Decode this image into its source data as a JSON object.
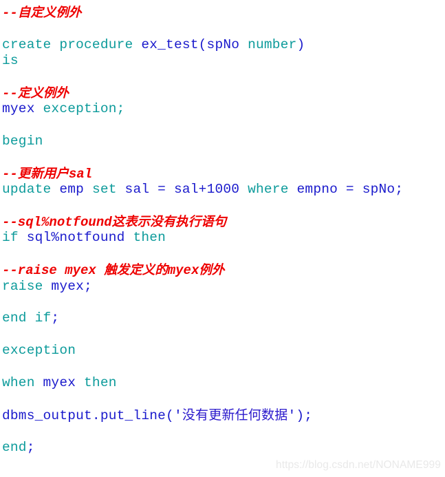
{
  "page": {
    "kind": "code-snippet",
    "language": "PL/SQL",
    "background_color": "#ffffff"
  },
  "colors": {
    "keyword": "#0d9b9b",
    "identifier": "#1a1acc",
    "string": "#2b1acc",
    "comment": "#ee0000",
    "watermark": "#e9e9e9"
  },
  "code": {
    "lines": [
      {
        "type": "comment",
        "text": "--自定义例外",
        "parts": [
          {
            "t": "--",
            "cls": "latin"
          },
          {
            "t": "自定义例外",
            "cls": "cn"
          }
        ]
      },
      {
        "type": "blank",
        "text": ""
      },
      {
        "type": "code",
        "text": "create procedure ex_test(spNo number)",
        "tokens": [
          {
            "t": "create procedure ",
            "k": "kw"
          },
          {
            "t": "ex_test(spNo",
            "k": "id"
          },
          {
            "t": " number",
            "k": "kw"
          },
          {
            "t": ")",
            "k": "id"
          }
        ]
      },
      {
        "type": "code",
        "text": "is",
        "tokens": [
          {
            "t": "is",
            "k": "kw"
          }
        ]
      },
      {
        "type": "blank",
        "text": ""
      },
      {
        "type": "comment",
        "text": "--定义例外",
        "parts": [
          {
            "t": "--",
            "cls": "latin"
          },
          {
            "t": "定义例外",
            "cls": "cn"
          }
        ]
      },
      {
        "type": "code",
        "text": "myex exception;",
        "tokens": [
          {
            "t": "myex",
            "k": "id"
          },
          {
            "t": " exception;",
            "k": "kw"
          }
        ]
      },
      {
        "type": "blank",
        "text": ""
      },
      {
        "type": "code",
        "text": "begin",
        "tokens": [
          {
            "t": "begin",
            "k": "kw"
          }
        ]
      },
      {
        "type": "blank",
        "text": ""
      },
      {
        "type": "comment",
        "text": "--更新用户sal",
        "parts": [
          {
            "t": "--",
            "cls": "latin"
          },
          {
            "t": "更新用户",
            "cls": "cn"
          },
          {
            "t": "sal",
            "cls": "latin"
          }
        ]
      },
      {
        "type": "code",
        "text": "update emp set sal = sal+1000 where empno = spNo;",
        "tokens": [
          {
            "t": "update",
            "k": "kw"
          },
          {
            "t": " emp ",
            "k": "id"
          },
          {
            "t": "set",
            "k": "kw"
          },
          {
            "t": " sal = sal+1000 ",
            "k": "id"
          },
          {
            "t": "where",
            "k": "kw"
          },
          {
            "t": " empno = spNo;",
            "k": "id"
          }
        ]
      },
      {
        "type": "blank",
        "text": ""
      },
      {
        "type": "comment",
        "text": "--sql%notfound这表示没有执行语句",
        "parts": [
          {
            "t": "--sql%notfound",
            "cls": "latin"
          },
          {
            "t": "这表示没有执行语句",
            "cls": "cn"
          }
        ]
      },
      {
        "type": "code",
        "text": "if sql%notfound then",
        "tokens": [
          {
            "t": "if",
            "k": "kw"
          },
          {
            "t": " sql%notfound ",
            "k": "id"
          },
          {
            "t": "then",
            "k": "kw"
          }
        ]
      },
      {
        "type": "blank",
        "text": ""
      },
      {
        "type": "comment",
        "text": "--raise myex 触发定义的myex例外",
        "parts": [
          {
            "t": "--raise myex ",
            "cls": "latin"
          },
          {
            "t": "触发定义的",
            "cls": "cn"
          },
          {
            "t": "myex",
            "cls": "latin"
          },
          {
            "t": "例外",
            "cls": "cn"
          }
        ]
      },
      {
        "type": "code",
        "text": "raise myex;",
        "tokens": [
          {
            "t": "raise",
            "k": "kw"
          },
          {
            "t": " myex;",
            "k": "id"
          }
        ]
      },
      {
        "type": "blank",
        "text": ""
      },
      {
        "type": "code",
        "text": "end if;",
        "tokens": [
          {
            "t": "end if",
            "k": "kw"
          },
          {
            "t": ";",
            "k": "id"
          }
        ]
      },
      {
        "type": "blank",
        "text": ""
      },
      {
        "type": "code",
        "text": "exception",
        "tokens": [
          {
            "t": "exception",
            "k": "kw"
          }
        ]
      },
      {
        "type": "blank",
        "text": ""
      },
      {
        "type": "code",
        "text": "when myex then",
        "tokens": [
          {
            "t": "when",
            "k": "kw"
          },
          {
            "t": " myex ",
            "k": "id"
          },
          {
            "t": "then",
            "k": "kw"
          }
        ]
      },
      {
        "type": "blank",
        "text": ""
      },
      {
        "type": "code",
        "text": "dbms_output.put_line('没有更新任何数据');",
        "tokens": [
          {
            "t": "dbms_output.put_line('",
            "k": "id"
          },
          {
            "t": "没有更新任何数据",
            "k": "str-cn"
          },
          {
            "t": "');",
            "k": "id"
          }
        ]
      },
      {
        "type": "blank",
        "text": ""
      },
      {
        "type": "code",
        "text": "end;",
        "tokens": [
          {
            "t": "end",
            "k": "kw"
          },
          {
            "t": ";",
            "k": "id"
          }
        ]
      }
    ]
  },
  "watermark": {
    "text": "https://blog.csdn.net/NONAME999"
  }
}
